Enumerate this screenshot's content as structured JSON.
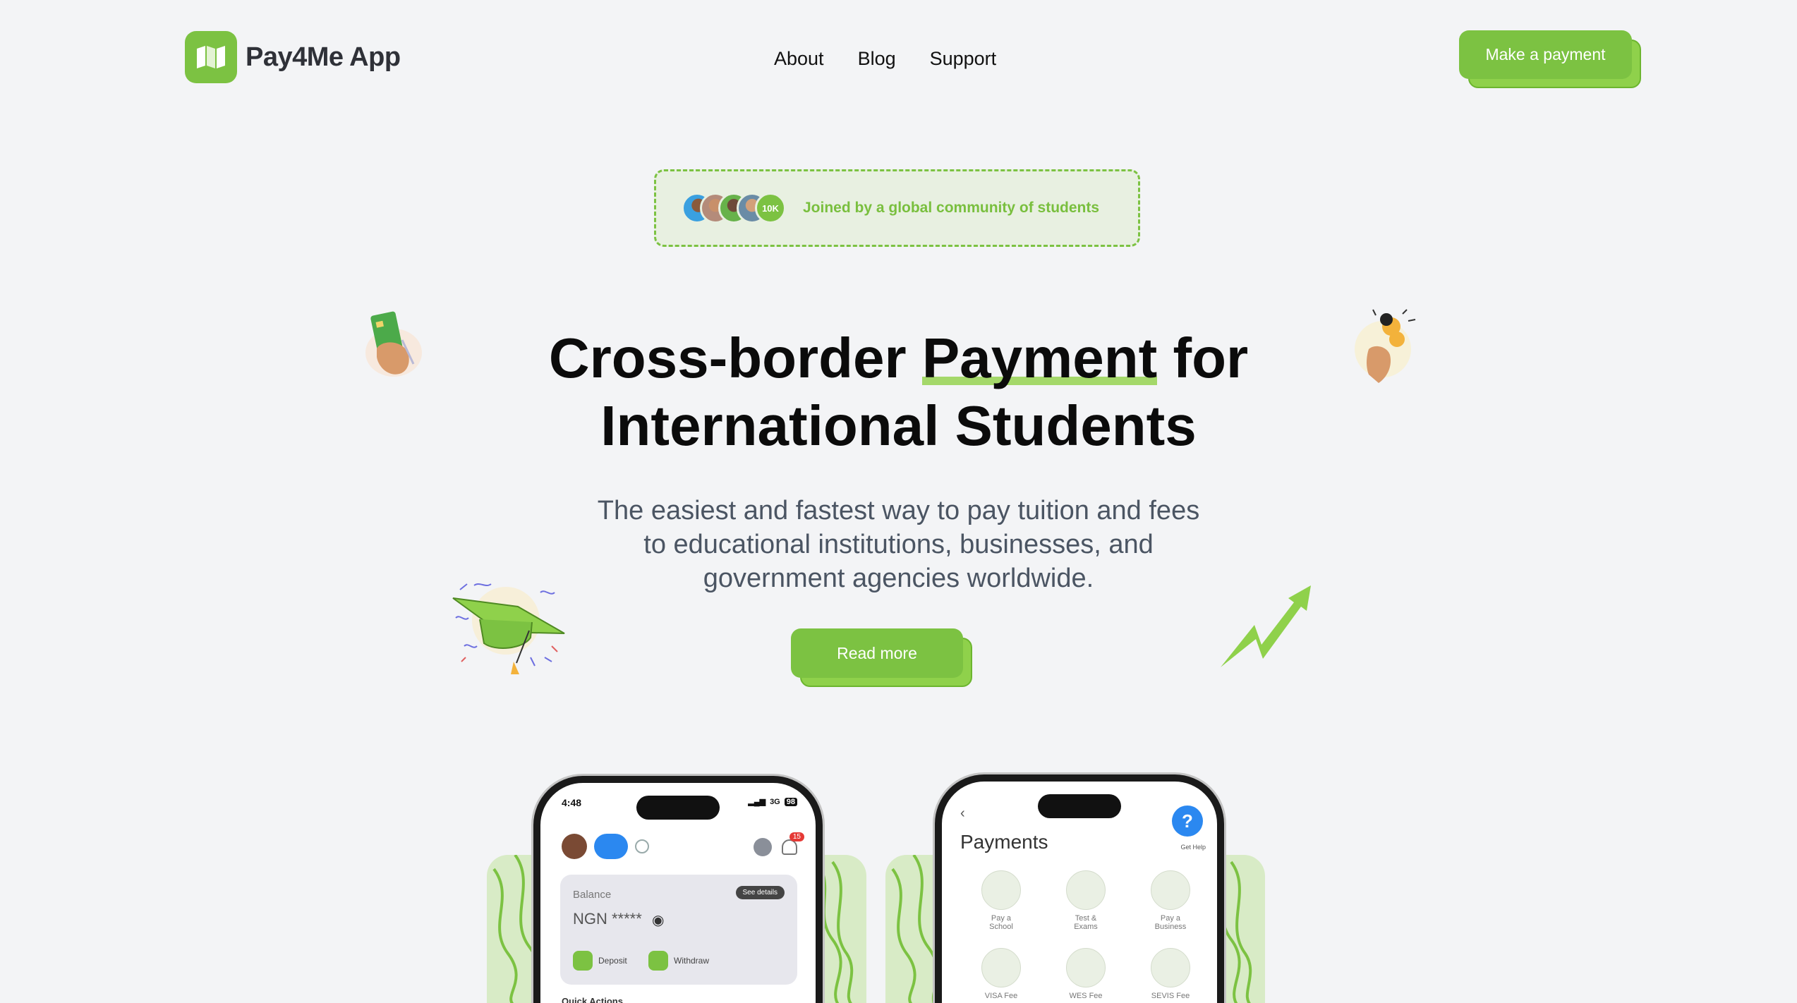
{
  "header": {
    "logo_text": "Pay4Me App",
    "nav": [
      "About",
      "Blog",
      "Support"
    ],
    "cta_label": "Make a payment"
  },
  "community": {
    "count_badge": "10K",
    "text": "Joined by a global community of students"
  },
  "hero": {
    "title_part1": "Cross-border",
    "title_highlight": "Payment",
    "title_part2": "for",
    "title_line2": "International Students",
    "subtitle_line1": "The easiest and fastest way to pay tuition and fees",
    "subtitle_line2": "to educational institutions, businesses, and",
    "subtitle_line3": "government agencies worldwide.",
    "read_more": "Read more"
  },
  "phone_left": {
    "time": "4:48",
    "signal": "3G",
    "battery": "98",
    "notification_count": "15",
    "balance_label": "Balance",
    "see_details": "See details",
    "balance_value": "NGN *****",
    "deposit": "Deposit",
    "withdraw": "Withdraw",
    "quick_actions": "Quick Actions"
  },
  "phone_right": {
    "title": "Payments",
    "get_help": "Get Help",
    "items": [
      {
        "line1": "Pay a",
        "line2": "School"
      },
      {
        "line1": "Test &",
        "line2": "Exams"
      },
      {
        "line1": "Pay a",
        "line2": "Business"
      },
      {
        "line1": "VISA Fee",
        "line2": ""
      },
      {
        "line1": "WES Fee",
        "line2": ""
      },
      {
        "line1": "SEVIS Fee",
        "line2": ""
      }
    ]
  },
  "colors": {
    "brand_green": "#7cc242",
    "background": "#f3f4f6",
    "pill_bg": "#e8f0e1"
  }
}
